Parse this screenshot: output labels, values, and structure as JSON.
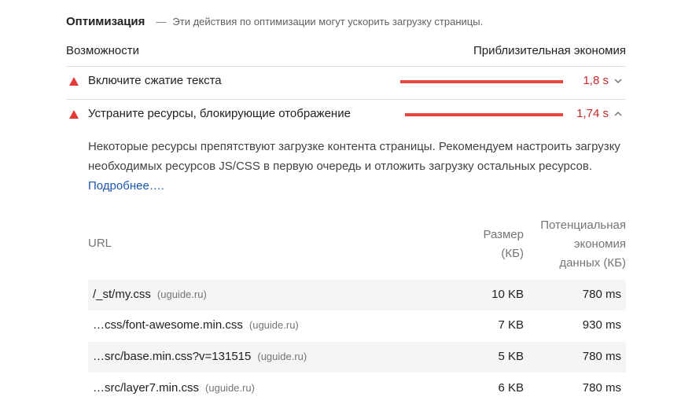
{
  "section": {
    "title": "Оптимизация",
    "dash": "—",
    "description": "Эти действия по оптимизации могут ускорить загрузку страницы."
  },
  "columns": {
    "left": "Возможности",
    "right": "Приблизительная экономия"
  },
  "audits": [
    {
      "title": "Включите сжатие текста",
      "savings": "1,8 s",
      "bar_fraction": 1.0,
      "expanded": false
    },
    {
      "title": "Устраните ресурсы, блокирующие отображение",
      "savings": "1,74 s",
      "bar_fraction": 0.97,
      "expanded": true
    }
  ],
  "details": {
    "text": "Некоторые ресурсы препятствуют загрузке контента страницы. Рекомендуем настроить загрузку необходимых ресурсов JS/CSS в первую очередь и отложить загрузку остальных ресурсов.",
    "link": "Подробнее…."
  },
  "table": {
    "headers": {
      "url": "URL",
      "size_line1": "Размер",
      "size_line2": "(КБ)",
      "savings_line1": "Потенциальная",
      "savings_line2": "экономия",
      "savings_line3": "данных (КБ)"
    },
    "rows": [
      {
        "url": "/_st/my.css",
        "host": "(uguide.ru)",
        "size": "10 KB",
        "savings": "780 ms"
      },
      {
        "url": "…css/font-awesome.min.css",
        "host": "(uguide.ru)",
        "size": "7 KB",
        "savings": "930 ms"
      },
      {
        "url": "…src/base.min.css?v=131515",
        "host": "(uguide.ru)",
        "size": "5 KB",
        "savings": "780 ms"
      },
      {
        "url": "…src/layer7.min.css",
        "host": "(uguide.ru)",
        "size": "6 KB",
        "savings": "780 ms"
      }
    ]
  },
  "colors": {
    "fail": "#e53935",
    "savings_text": "#c62828",
    "link": "#1a56b0"
  },
  "icons": [
    "warning-triangle-icon",
    "chevron-down-icon",
    "chevron-up-icon"
  ]
}
